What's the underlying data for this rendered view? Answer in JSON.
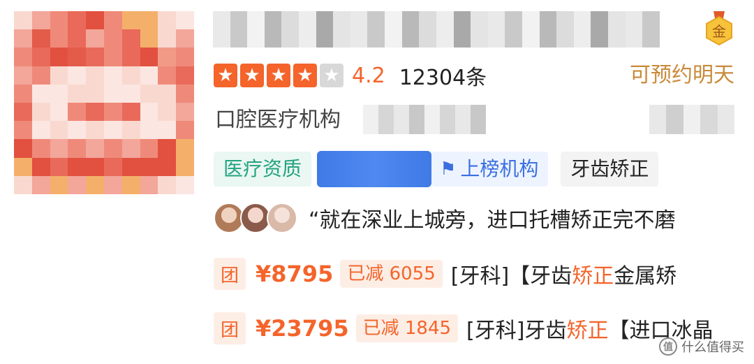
{
  "store": {
    "rating": {
      "score": "4.2",
      "stars_filled": 4,
      "stars_total": 5,
      "review_count": "12304条"
    },
    "reserve_text": "可预约明天",
    "gold_badge_char": "金",
    "category": "口腔医疗机构",
    "tags": {
      "medical": "医疗资质",
      "ranked": "上榜机构",
      "service": "牙齿矫正"
    },
    "review": {
      "text": "“就在深业上城旁，进口托槽矫正完不磨"
    },
    "deals": [
      {
        "badge": "团",
        "price": "¥8795",
        "discount": "已减 6055",
        "title_prefix": "[牙科]【牙齿",
        "title_highlight": "矫正",
        "title_suffix": "金属矫"
      },
      {
        "badge": "团",
        "price": "¥23795",
        "discount": "已减 1845",
        "title_prefix": "[牙科]牙齿",
        "title_highlight": "矫正",
        "title_suffix": "【进口冰晶"
      }
    ]
  },
  "watermark": {
    "text": "什么值得买",
    "icon_char": "值"
  },
  "colors": {
    "accent": "#f4642b",
    "gold": "#c98a3a",
    "green": "#24a37e",
    "blue": "#3b6fe0"
  }
}
